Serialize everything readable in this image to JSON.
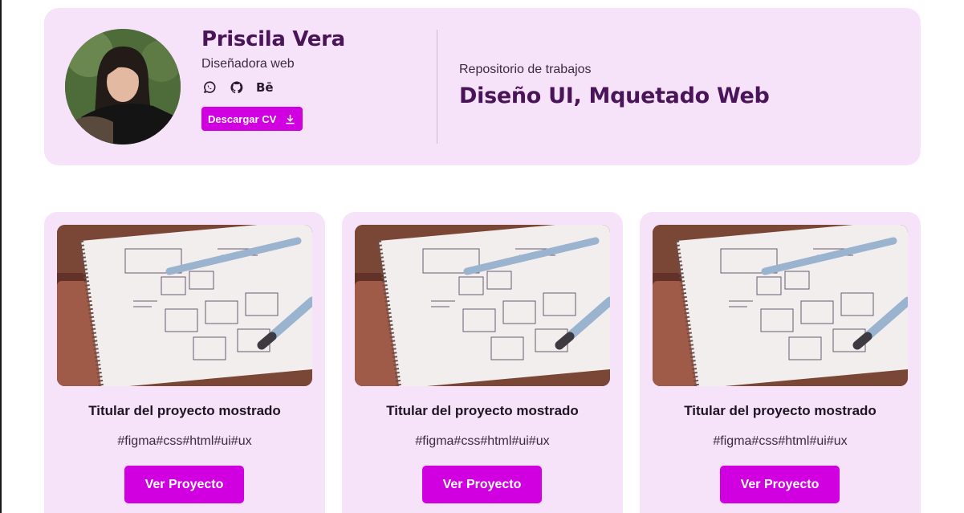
{
  "profile": {
    "name": "Priscila Vera",
    "role": "Diseñadora web",
    "socials": [
      "whatsapp-icon",
      "github-icon",
      "behance-icon"
    ],
    "behance_label": "Bē",
    "cv_button": "Descargar CV"
  },
  "repository": {
    "label": "Repositorio de trabajos",
    "title": "Diseño UI, Mquetado Web"
  },
  "projects": [
    {
      "title": "Titular del proyecto mostrado",
      "tags": "#figma#css#html#ui#ux",
      "button": "Ver Proyecto"
    },
    {
      "title": "Titular del proyecto mostrado",
      "tags": "#figma#css#html#ui#ux",
      "button": "Ver Proyecto"
    },
    {
      "title": "Titular del proyecto mostrado",
      "tags": "#figma#css#html#ui#ux",
      "button": "Ver Proyecto"
    }
  ],
  "colors": {
    "card_background": "#f6e2f9",
    "accent": "#d100e0",
    "heading": "#4a1458"
  }
}
